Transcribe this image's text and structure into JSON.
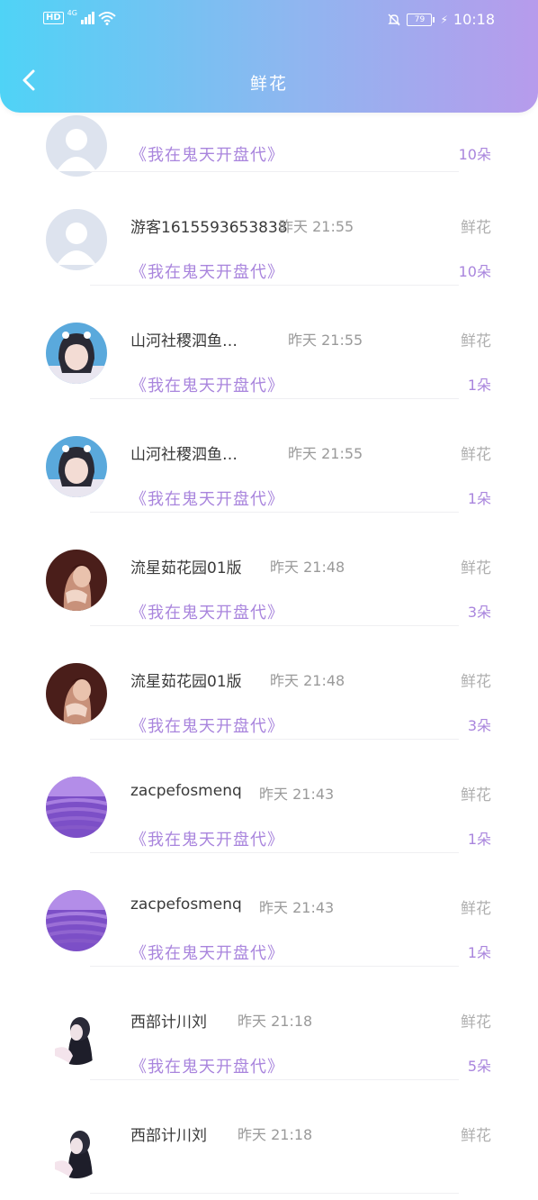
{
  "status_bar": {
    "hd": "HD",
    "network": "4G",
    "battery": "79",
    "time": "10:18"
  },
  "header": {
    "title": "鲜花",
    "accent_gradient": [
      "#4fd3f6",
      "#b79bec"
    ]
  },
  "records": [
    {
      "name": "",
      "time": "",
      "book": "《我在鬼天开盘代》",
      "type": "",
      "count": "10朵",
      "avatar": "default"
    },
    {
      "name": "游客1615593653838",
      "time": "昨天 21:55",
      "book": "《我在鬼天开盘代》",
      "type": "鲜花",
      "count": "10朵",
      "avatar": "default"
    },
    {
      "name": "山河社稷泗鱼…",
      "time": "昨天 21:55",
      "book": "《我在鬼天开盘代》",
      "type": "鲜花",
      "count": "1朵",
      "avatar": "girl"
    },
    {
      "name": "山河社稷泗鱼…",
      "time": "昨天 21:55",
      "book": "《我在鬼天开盘代》",
      "type": "鲜花",
      "count": "1朵",
      "avatar": "girl"
    },
    {
      "name": "流星茹花园01版",
      "time": "昨天 21:48",
      "book": "《我在鬼天开盘代》",
      "type": "鲜花",
      "count": "3朵",
      "avatar": "portrait"
    },
    {
      "name": "流星茹花园01版",
      "time": "昨天 21:48",
      "book": "《我在鬼天开盘代》",
      "type": "鲜花",
      "count": "3朵",
      "avatar": "portrait"
    },
    {
      "name": "zacpefosmenq",
      "time": "昨天 21:43",
      "book": "《我在鬼天开盘代》",
      "type": "鲜花",
      "count": "1朵",
      "avatar": "lavender"
    },
    {
      "name": "zacpefosmenq",
      "time": "昨天 21:43",
      "book": "《我在鬼天开盘代》",
      "type": "鲜花",
      "count": "1朵",
      "avatar": "lavender"
    },
    {
      "name": "西部计川刘",
      "time": "昨天 21:18",
      "book": "《我在鬼天开盘代》",
      "type": "鲜花",
      "count": "5朵",
      "avatar": "anime"
    },
    {
      "name": "西部计川刘",
      "time": "昨天 21:18",
      "book": "",
      "type": "鲜花",
      "count": "",
      "avatar": "anime"
    }
  ]
}
